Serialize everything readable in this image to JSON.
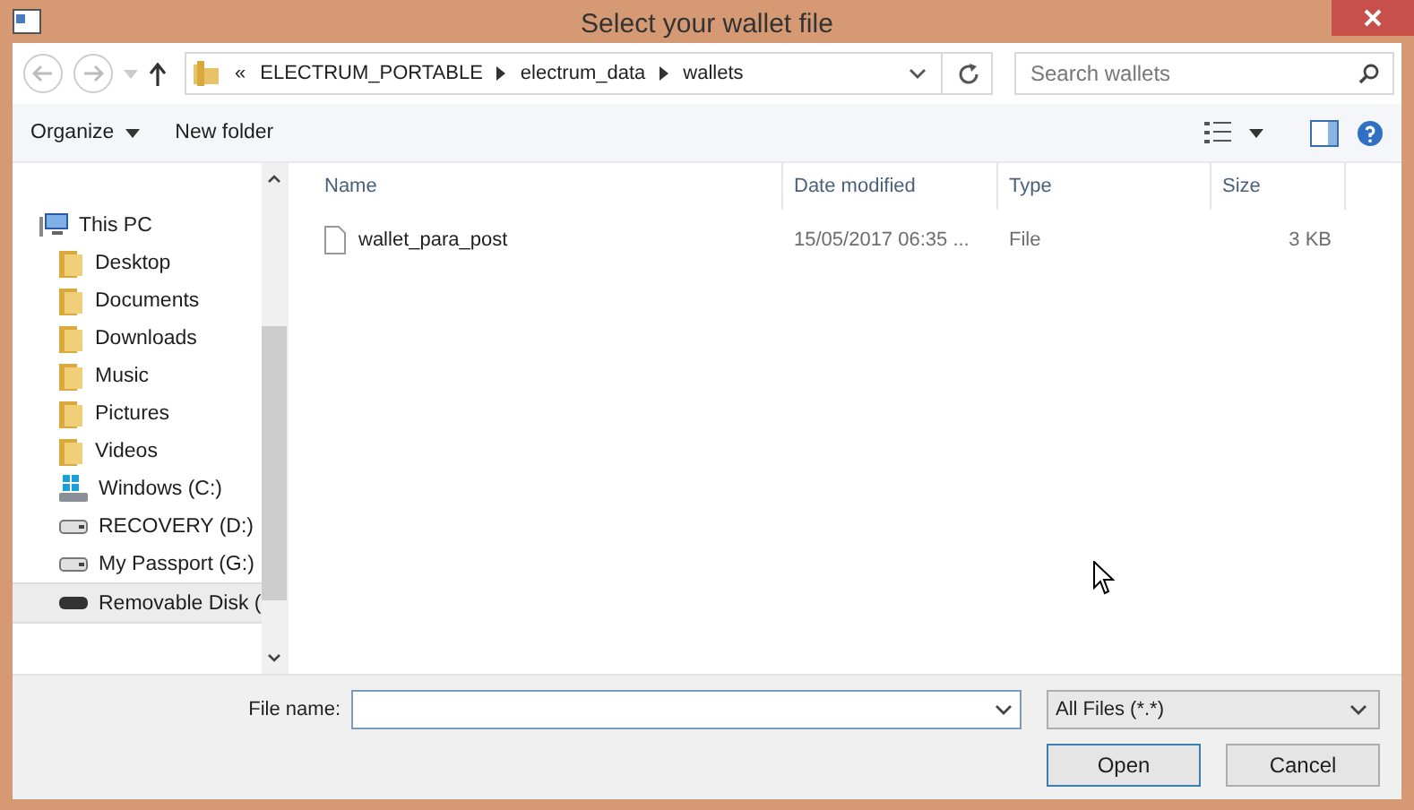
{
  "window": {
    "title": "Select your wallet file"
  },
  "address": {
    "overflow": "«",
    "segments": [
      "ELECTRUM_PORTABLE",
      "electrum_data",
      "wallets"
    ]
  },
  "search": {
    "placeholder": "Search wallets"
  },
  "toolbar": {
    "organize": "Organize",
    "new_folder": "New folder"
  },
  "sidebar": {
    "items": [
      {
        "label": "This PC",
        "kind": "pc",
        "selected": false,
        "children": [
          {
            "label": "Desktop",
            "kind": "folder",
            "selected": false
          },
          {
            "label": "Documents",
            "kind": "folder",
            "selected": false
          },
          {
            "label": "Downloads",
            "kind": "folder",
            "selected": false
          },
          {
            "label": "Music",
            "kind": "folder",
            "selected": false
          },
          {
            "label": "Pictures",
            "kind": "folder",
            "selected": false
          },
          {
            "label": "Videos",
            "kind": "folder",
            "selected": false
          },
          {
            "label": "Windows (C:)",
            "kind": "windrive",
            "selected": false
          },
          {
            "label": "RECOVERY (D:)",
            "kind": "drive",
            "selected": false
          },
          {
            "label": "My Passport (G:)",
            "kind": "drive",
            "selected": false
          },
          {
            "label": "Removable Disk (",
            "kind": "usb",
            "selected": true
          }
        ]
      }
    ]
  },
  "table": {
    "columns": [
      "Name",
      "Date modified",
      "Type",
      "Size"
    ],
    "rows": [
      {
        "name": "wallet_para_post",
        "date": "15/05/2017 06:35 ...",
        "type": "File",
        "size": "3 KB",
        "selected": false
      }
    ]
  },
  "file_name": {
    "label": "File name:"
  },
  "filter": {
    "value": "All Files (*.*)"
  },
  "buttons": [
    "Open",
    "Cancel"
  ]
}
